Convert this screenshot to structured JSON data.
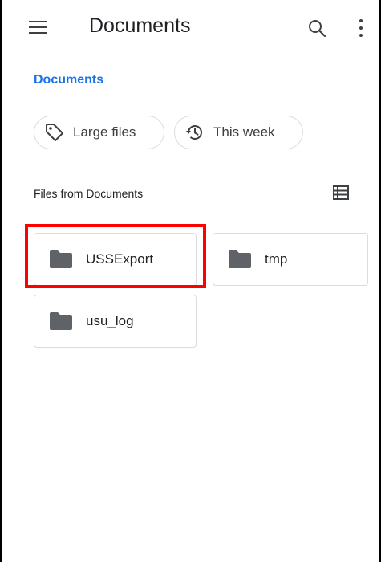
{
  "app_bar": {
    "title": "Documents"
  },
  "breadcrumb": "Documents",
  "chips": [
    {
      "label": "Large files",
      "icon": "tag-icon"
    },
    {
      "label": "This week",
      "icon": "history-icon"
    }
  ],
  "section": {
    "label": "Files from Documents"
  },
  "folders": [
    {
      "name": "USSExport",
      "icon": "folder-icon"
    },
    {
      "name": "tmp",
      "icon": "folder-icon"
    },
    {
      "name": "usu_log",
      "icon": "folder-icon"
    }
  ],
  "colors": {
    "accent": "#1a73e8",
    "highlight": "#ff0000",
    "folder_icon": "#5f6368"
  }
}
